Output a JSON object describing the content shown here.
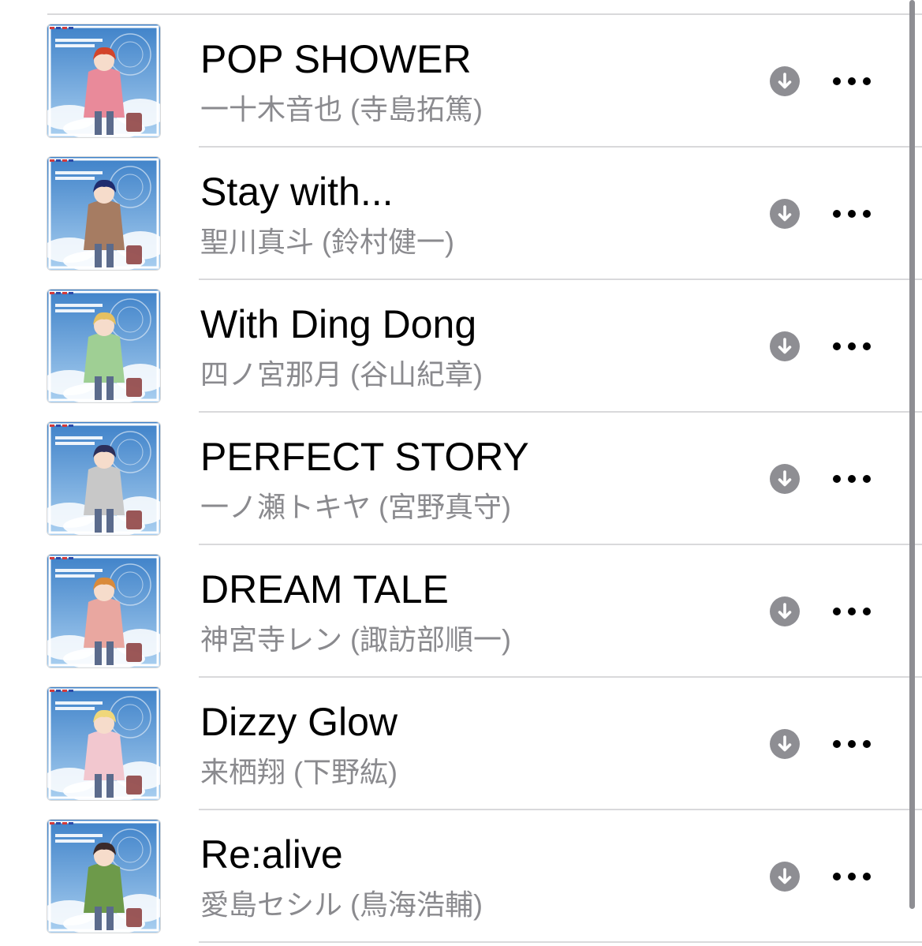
{
  "tracks": [
    {
      "title": "POP SHOWER",
      "artist": "一十木音也 (寺島拓篤)",
      "artwork": {
        "hair": "#d2442a",
        "coat": "#e98a9a",
        "sky_top": "#3f82c9",
        "sky_bottom": "#a9cff0"
      }
    },
    {
      "title": "Stay with...",
      "artist": "聖川真斗 (鈴村健一)",
      "artwork": {
        "hair": "#1f2c6e",
        "coat": "#a67c62",
        "sky_top": "#3f82c9",
        "sky_bottom": "#a9cff0"
      }
    },
    {
      "title": "With Ding Dong",
      "artist": "四ノ宮那月 (谷山紀章)",
      "artwork": {
        "hair": "#e5c061",
        "coat": "#9fcf94",
        "sky_top": "#3f82c9",
        "sky_bottom": "#a9cff0"
      }
    },
    {
      "title": "PERFECT STORY",
      "artist": "一ノ瀬トキヤ (宮野真守)",
      "artwork": {
        "hair": "#2c2f5a",
        "coat": "#c8c8c8",
        "sky_top": "#3f82c9",
        "sky_bottom": "#a9cff0"
      }
    },
    {
      "title": "DREAM TALE",
      "artist": "神宮寺レン (諏訪部順一)",
      "artwork": {
        "hair": "#d98a3a",
        "coat": "#e9a7a0",
        "sky_top": "#3f82c9",
        "sky_bottom": "#a9cff0"
      }
    },
    {
      "title": "Dizzy Glow",
      "artist": "来栖翔 (下野紘)",
      "artwork": {
        "hair": "#f0d77a",
        "coat": "#f2c7cf",
        "sky_top": "#3f82c9",
        "sky_bottom": "#a9cff0"
      }
    },
    {
      "title": "Re:alive",
      "artist": "愛島セシル (鳥海浩輔)",
      "artwork": {
        "hair": "#3b2a2a",
        "coat": "#6d9a4a",
        "sky_top": "#3f82c9",
        "sky_bottom": "#a9cff0"
      }
    }
  ],
  "icons": {
    "download": "download-icon",
    "more": "more-icon"
  },
  "colors": {
    "title_text": "#000000",
    "subtitle_text": "#8a8a8e",
    "icon_gray": "#8e8e93",
    "divider": "#d9d9db"
  }
}
